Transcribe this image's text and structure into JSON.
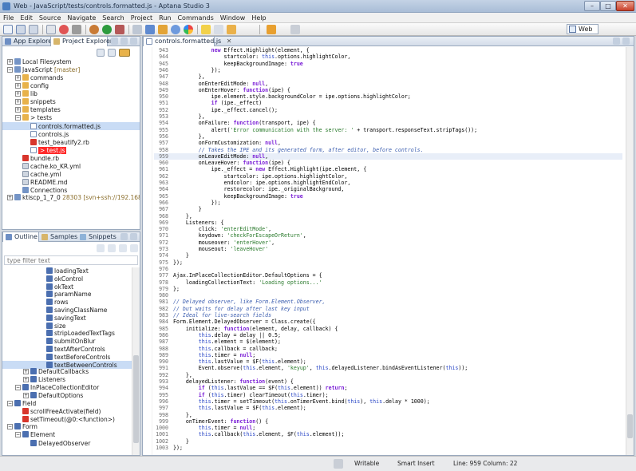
{
  "window": {
    "title": "Web - JavaScript/tests/controls.formatted.js - Aptana Studio 3",
    "controls": [
      "–",
      "□",
      "✕"
    ]
  },
  "menu": [
    "File",
    "Edit",
    "Source",
    "Navigate",
    "Search",
    "Project",
    "Run",
    "Commands",
    "Window",
    "Help"
  ],
  "toolbar": {
    "perspective_label": "Web"
  },
  "left_top": {
    "tabs": [
      "App Explorer",
      "Project Explorer"
    ],
    "tree": [
      {
        "depth": 0,
        "exp": "+",
        "icon": "proj",
        "label": "Local Filesystem"
      },
      {
        "depth": 0,
        "exp": "−",
        "icon": "proj",
        "label": "JavaScript",
        "note": " [master]"
      },
      {
        "depth": 1,
        "exp": "+",
        "icon": "folder",
        "label": "commands"
      },
      {
        "depth": 1,
        "exp": "+",
        "icon": "folder",
        "label": "config"
      },
      {
        "depth": 1,
        "exp": "+",
        "icon": "folder",
        "label": "lib"
      },
      {
        "depth": 1,
        "exp": "+",
        "icon": "folder",
        "label": "snippets"
      },
      {
        "depth": 1,
        "exp": "+",
        "icon": "folder",
        "label": "templates"
      },
      {
        "depth": 1,
        "exp": "−",
        "icon": "folder",
        "label": "> tests"
      },
      {
        "depth": 2,
        "exp": "",
        "icon": "file-js",
        "label": "controls.formatted.js",
        "state": "selected"
      },
      {
        "depth": 2,
        "exp": "",
        "icon": "file-js",
        "label": "controls.js"
      },
      {
        "depth": 2,
        "exp": "",
        "icon": "file-rb",
        "label": "test_beautify2.rb"
      },
      {
        "depth": 2,
        "exp": "",
        "icon": "file-js",
        "label": "> test.js",
        "state": "error"
      },
      {
        "depth": 1,
        "exp": "",
        "icon": "file-rb",
        "label": "bundle.rb"
      },
      {
        "depth": 1,
        "exp": "",
        "icon": "file-yml",
        "label": "cache.ko_KR.yml"
      },
      {
        "depth": 1,
        "exp": "",
        "icon": "file-yml",
        "label": "cache.yml"
      },
      {
        "depth": 1,
        "exp": "",
        "icon": "file-yml",
        "label": "README.md"
      },
      {
        "depth": 1,
        "exp": "",
        "icon": "proj",
        "label": "Connections"
      },
      {
        "depth": 0,
        "exp": "+",
        "icon": "proj",
        "label": "ktiscp_1_7_0",
        "note": " 28303 [svn+ssh://192.168.1.15/da"
      }
    ]
  },
  "left_bottom": {
    "tabs": [
      "Outline",
      "Samples",
      "Snippets"
    ],
    "filter_placeholder": "type filter text",
    "tree": [
      {
        "depth": 4,
        "exp": "",
        "icon": "fld",
        "label": "loadingText"
      },
      {
        "depth": 4,
        "exp": "",
        "icon": "fld",
        "label": "okControl"
      },
      {
        "depth": 4,
        "exp": "",
        "icon": "fld",
        "label": "okText"
      },
      {
        "depth": 4,
        "exp": "",
        "icon": "fld",
        "label": "paramName"
      },
      {
        "depth": 4,
        "exp": "",
        "icon": "fld",
        "label": "rows"
      },
      {
        "depth": 4,
        "exp": "",
        "icon": "fld",
        "label": "savingClassName"
      },
      {
        "depth": 4,
        "exp": "",
        "icon": "fld",
        "label": "savingText"
      },
      {
        "depth": 4,
        "exp": "",
        "icon": "fld",
        "label": "size"
      },
      {
        "depth": 4,
        "exp": "",
        "icon": "fld",
        "label": "stripLoadedTextTags"
      },
      {
        "depth": 4,
        "exp": "",
        "icon": "fld",
        "label": "submitOnBlur"
      },
      {
        "depth": 4,
        "exp": "",
        "icon": "fld",
        "label": "textAfterControls"
      },
      {
        "depth": 4,
        "exp": "",
        "icon": "fld",
        "label": "textBeforeControls"
      },
      {
        "depth": 4,
        "exp": "",
        "icon": "fld",
        "label": "textBetweenControls",
        "state": "selected"
      },
      {
        "depth": 2,
        "exp": "+",
        "icon": "fld",
        "label": "DefaultCallbacks"
      },
      {
        "depth": 2,
        "exp": "+",
        "icon": "fld",
        "label": "Listeners"
      },
      {
        "depth": 1,
        "exp": "−",
        "icon": "fld",
        "label": "InPlaceCollectionEditor"
      },
      {
        "depth": 2,
        "exp": "+",
        "icon": "fld",
        "label": "DefaultOptions"
      },
      {
        "depth": 0,
        "exp": "−",
        "icon": "fld",
        "label": "Field"
      },
      {
        "depth": 1,
        "exp": "",
        "icon": "file-rb",
        "label": "scrollFreeActivate(field)"
      },
      {
        "depth": 1,
        "exp": "",
        "icon": "file-rb",
        "label": "setTimeout(@0:<function>)"
      },
      {
        "depth": 0,
        "exp": "−",
        "icon": "fld",
        "label": "Form"
      },
      {
        "depth": 1,
        "exp": "−",
        "icon": "fld",
        "label": "Element"
      },
      {
        "depth": 2,
        "exp": "",
        "icon": "fld",
        "label": "DelayedObserver"
      }
    ]
  },
  "editor": {
    "tab_label": "controls.formatted.js",
    "highlight_line": 959,
    "lines": [
      {
        "n": "943",
        "t": "            new Effect.Highlight(element, {"
      },
      {
        "n": "944",
        "t": "                startcolor: this.options.highlightColor,"
      },
      {
        "n": "945",
        "t": "                keepBackgroundImage: true"
      },
      {
        "n": "946",
        "t": "            });"
      },
      {
        "n": "947",
        "t": "        },"
      },
      {
        "n": "948",
        "t": "        onEnterEditMode: null,"
      },
      {
        "n": "949",
        "t": "        onEnterHover: function(ipe) {"
      },
      {
        "n": "950",
        "t": "            ipe.element.style.backgroundColor = ipe.options.highlightColor;"
      },
      {
        "n": "951",
        "t": "            if (ipe._effect)"
      },
      {
        "n": "952",
        "t": "            ipe._effect.cancel();"
      },
      {
        "n": "953",
        "t": "        },"
      },
      {
        "n": "954",
        "t": "        onFailure: function(transport, ipe) {"
      },
      {
        "n": "955",
        "t": "            alert('Error communication with the server: ' + transport.responseText.stripTags());"
      },
      {
        "n": "956",
        "t": "        },"
      },
      {
        "n": "957",
        "t": "        onFormCustomization: null,"
      },
      {
        "n": "958",
        "t": "        // Takes the IPE and its generated form, after editor, before controls."
      },
      {
        "n": "959",
        "t": "        onLeaveEditMode: null,"
      },
      {
        "n": "960",
        "t": "        onLeaveHover: function(ipe) {"
      },
      {
        "n": "961",
        "t": "            ipe._effect = new Effect.Highlight(ipe.element, {"
      },
      {
        "n": "962",
        "t": "                startcolor: ipe.options.highlightColor,"
      },
      {
        "n": "963",
        "t": "                endcolor: ipe.options.highlightEndColor,"
      },
      {
        "n": "964",
        "t": "                restorecolor: ipe._originalBackground,"
      },
      {
        "n": "965",
        "t": "                keepBackgroundImage: true"
      },
      {
        "n": "966",
        "t": "            });"
      },
      {
        "n": "967",
        "t": "        }"
      },
      {
        "n": "968",
        "t": "    },"
      },
      {
        "n": "969",
        "t": "    Listeners: {"
      },
      {
        "n": "970",
        "t": "        click: 'enterEditMode',"
      },
      {
        "n": "971",
        "t": "        keydown: 'checkForEscapeOrReturn',"
      },
      {
        "n": "972",
        "t": "        mouseover: 'enterHover',"
      },
      {
        "n": "973",
        "t": "        mouseout: 'leaveHover'"
      },
      {
        "n": "974",
        "t": "    }"
      },
      {
        "n": "975",
        "t": "});"
      },
      {
        "n": "976",
        "t": ""
      },
      {
        "n": "977",
        "t": "Ajax.InPlaceCollectionEditor.DefaultOptions = {"
      },
      {
        "n": "978",
        "t": "    loadingCollectionText: 'Loading options...'"
      },
      {
        "n": "979",
        "t": "};"
      },
      {
        "n": "980",
        "t": ""
      },
      {
        "n": "981",
        "t": "// Delayed observer, like Form.Element.Observer,"
      },
      {
        "n": "982",
        "t": "// but waits for delay after last key input"
      },
      {
        "n": "983",
        "t": "// Ideal for live-search fields"
      },
      {
        "n": "984",
        "t": "Form.Element.DelayedObserver = Class.create({"
      },
      {
        "n": "985",
        "t": "    initialize: function(element, delay, callback) {"
      },
      {
        "n": "986",
        "t": "        this.delay = delay || 0.5;"
      },
      {
        "n": "987",
        "t": "        this.element = $(element);"
      },
      {
        "n": "988",
        "t": "        this.callback = callback;"
      },
      {
        "n": "989",
        "t": "        this.timer = null;"
      },
      {
        "n": "990",
        "t": "        this.lastValue = $F(this.element);"
      },
      {
        "n": "991",
        "t": "        Event.observe(this.element, 'keyup', this.delayedListener.bindAsEventListener(this));"
      },
      {
        "n": "992",
        "t": "    },"
      },
      {
        "n": "993",
        "t": "    delayedListener: function(event) {"
      },
      {
        "n": "994",
        "t": "        if (this.lastValue == $F(this.element)) return;"
      },
      {
        "n": "995",
        "t": "        if (this.timer) clearTimeout(this.timer);"
      },
      {
        "n": "996",
        "t": "        this.timer = setTimeout(this.onTimerEvent.bind(this), this.delay * 1000);"
      },
      {
        "n": "997",
        "t": "        this.lastValue = $F(this.element);"
      },
      {
        "n": "998",
        "t": "    },"
      },
      {
        "n": "999",
        "t": "    onTimerEvent: function() {"
      },
      {
        "n": "1000",
        "t": "        this.timer = null;"
      },
      {
        "n": "1001",
        "t": "        this.callback(this.element, $F(this.element));"
      },
      {
        "n": "1002",
        "t": "    }"
      },
      {
        "n": "1003",
        "t": "});"
      }
    ]
  },
  "status": {
    "mode": "Writable",
    "insert": "Smart Insert",
    "position": "Line: 959 Column: 22"
  }
}
